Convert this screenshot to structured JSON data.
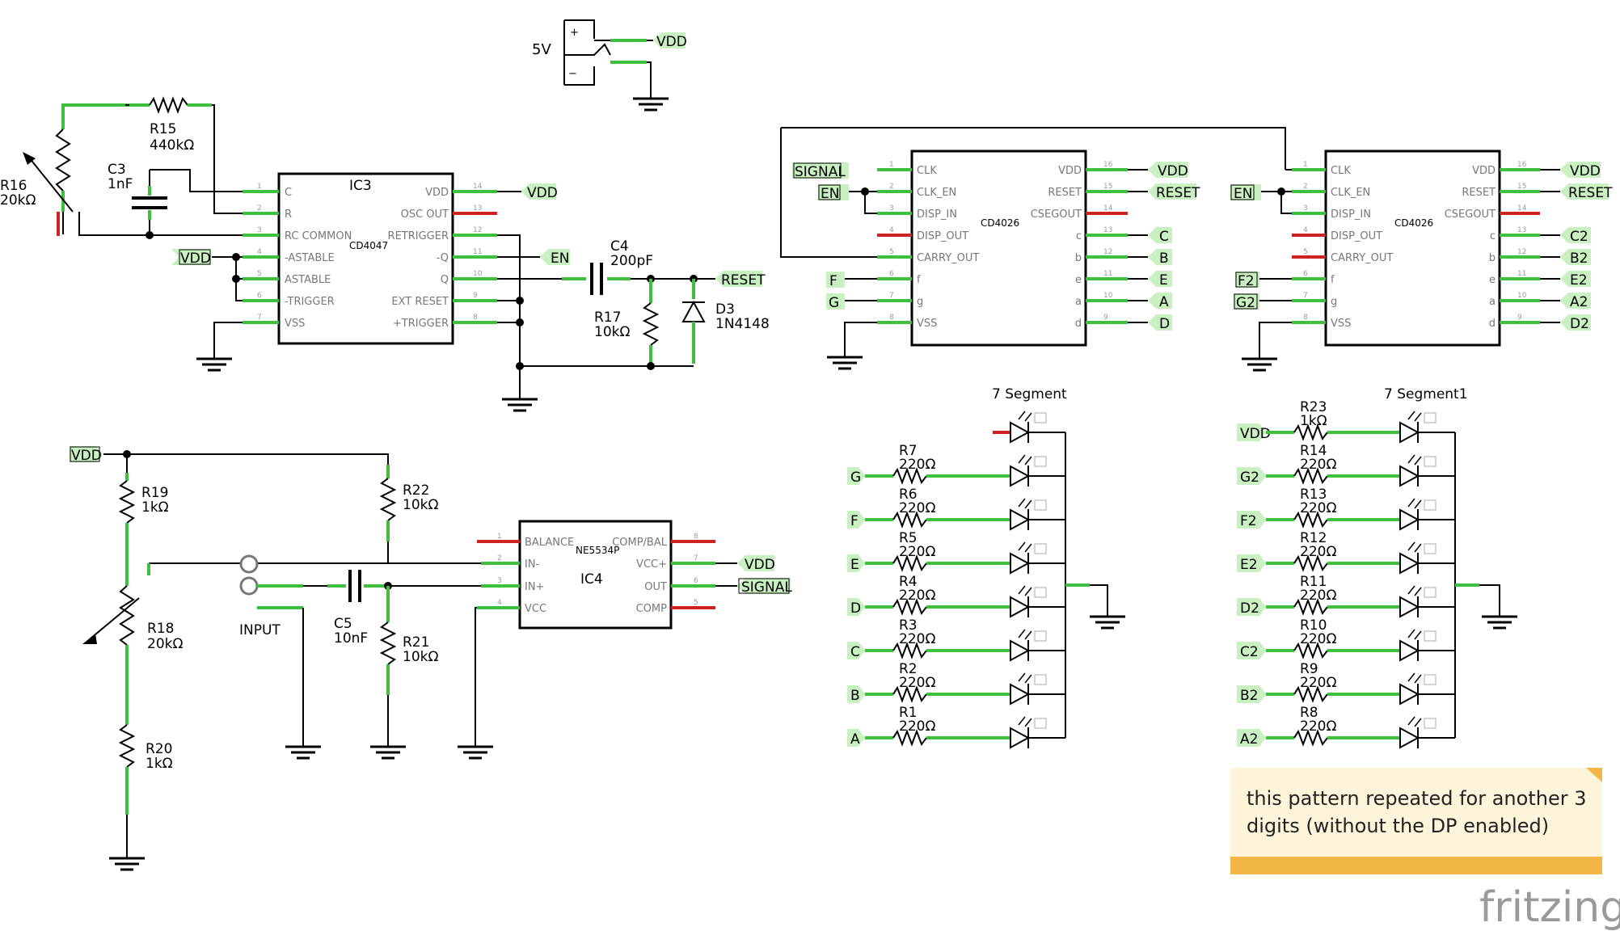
{
  "power": {
    "label": "5V",
    "net": "VDD"
  },
  "ic3": {
    "ref": "IC3",
    "part": "CD4047",
    "left_pins": [
      "C",
      "R",
      "RC COMMON",
      "-ASTABLE",
      "ASTABLE",
      "-TRIGGER",
      "VSS"
    ],
    "left_nums": [
      "1",
      "2",
      "3",
      "4",
      "5",
      "6",
      "7"
    ],
    "right_pins": [
      "VDD",
      "OSC OUT",
      "RETRIGGER",
      "-Q",
      "Q",
      "EXT RESET",
      "+TRIGGER"
    ],
    "right_nums": [
      "14",
      "13",
      "12",
      "11",
      "10",
      "9",
      "8"
    ]
  },
  "ic4": {
    "ref": "IC4",
    "part": "NE5534P",
    "left_pins": [
      "BALANCE",
      "IN-",
      "IN+",
      "VCC"
    ],
    "left_nums": [
      "1",
      "2",
      "3",
      "4"
    ],
    "right_pins": [
      "COMP/BAL",
      "VCC+",
      "OUT",
      "COMP"
    ],
    "right_nums": [
      "8",
      "7",
      "6",
      "5"
    ]
  },
  "counter_pins": {
    "part": "CD4026",
    "left": [
      "CLK",
      "CLK_EN",
      "DISP_IN",
      "DISP_OUT",
      "CARRY_OUT",
      "f",
      "g",
      "VSS"
    ],
    "left_nums": [
      "1",
      "2",
      "3",
      "4",
      "5",
      "6",
      "7",
      "8"
    ],
    "right": [
      "VDD",
      "RESET",
      "CSEGOUT",
      "c",
      "b",
      "e",
      "a",
      "d"
    ],
    "right_nums": [
      "16",
      "15",
      "14",
      "13",
      "12",
      "11",
      "10",
      "9"
    ]
  },
  "counter1": {
    "left_nets": [
      "SIGNAL",
      "EN",
      "",
      "",
      "",
      "F",
      "G",
      ""
    ],
    "right_nets": [
      "VDD",
      "RESET",
      "",
      "C",
      "B",
      "E",
      "A",
      "D"
    ]
  },
  "counter2": {
    "left_nets": [
      "",
      "EN",
      "",
      "",
      "",
      "F2",
      "G2",
      ""
    ],
    "right_nets": [
      "VDD",
      "RESET",
      "",
      "C2",
      "B2",
      "E2",
      "A2",
      "D2"
    ]
  },
  "components": {
    "r15": {
      "ref": "R15",
      "val": "440kΩ"
    },
    "r16": {
      "ref": "R16",
      "val": "20kΩ"
    },
    "c3": {
      "ref": "C3",
      "val": "1nF"
    },
    "c4": {
      "ref": "C4",
      "val": "200pF"
    },
    "r17": {
      "ref": "R17",
      "val": "10kΩ"
    },
    "d3": {
      "ref": "D3",
      "val": "1N4148"
    },
    "r19": {
      "ref": "R19",
      "val": "1kΩ"
    },
    "r18": {
      "ref": "R18",
      "val": "20kΩ"
    },
    "r20": {
      "ref": "R20",
      "val": "1kΩ"
    },
    "r22": {
      "ref": "R22",
      "val": "10kΩ"
    },
    "r21": {
      "ref": "R21",
      "val": "10kΩ"
    },
    "c5": {
      "ref": "C5",
      "val": "10nF"
    }
  },
  "input": {
    "label": "INPUT"
  },
  "nets": {
    "vdd": "VDD",
    "en": "EN",
    "reset": "RESET",
    "signal": "SIGNAL"
  },
  "display1": {
    "title": "7 Segment",
    "rows": [
      {
        "net": "",
        "ref": "",
        "val": ""
      },
      {
        "net": "G",
        "ref": "R7",
        "val": "220Ω"
      },
      {
        "net": "F",
        "ref": "R6",
        "val": "220Ω"
      },
      {
        "net": "E",
        "ref": "R5",
        "val": "220Ω"
      },
      {
        "net": "D",
        "ref": "R4",
        "val": "220Ω"
      },
      {
        "net": "C",
        "ref": "R3",
        "val": "220Ω"
      },
      {
        "net": "B",
        "ref": "R2",
        "val": "220Ω"
      },
      {
        "net": "A",
        "ref": "R1",
        "val": "220Ω"
      }
    ]
  },
  "display2": {
    "title": "7 Segment1",
    "rows": [
      {
        "net": "VDD",
        "ref": "R23",
        "val": "1kΩ"
      },
      {
        "net": "G2",
        "ref": "R14",
        "val": "220Ω"
      },
      {
        "net": "F2",
        "ref": "R13",
        "val": "220Ω"
      },
      {
        "net": "E2",
        "ref": "R12",
        "val": "220Ω"
      },
      {
        "net": "D2",
        "ref": "R11",
        "val": "220Ω"
      },
      {
        "net": "C2",
        "ref": "R10",
        "val": "220Ω"
      },
      {
        "net": "B2",
        "ref": "R9",
        "val": "220Ω"
      },
      {
        "net": "A2",
        "ref": "R8",
        "val": "220Ω"
      }
    ]
  },
  "note": {
    "line1": "this pattern repeated for another 3",
    "line2": "digits (without the DP enabled)"
  },
  "brand": "fritzing",
  "colors": {
    "wire": "#000000",
    "pin": "#3fbf3f",
    "unconnected": "#cc2222",
    "note": "#fdf4d9",
    "note_bar": "#f2b845"
  }
}
